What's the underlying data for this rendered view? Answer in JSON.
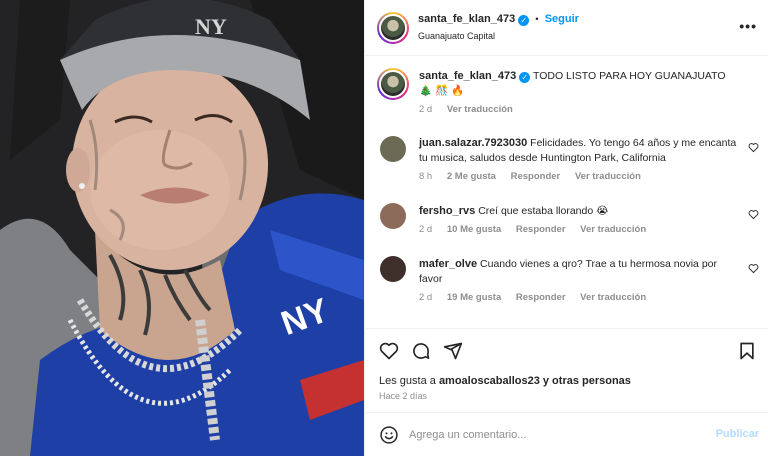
{
  "post": {
    "username": "santa_fe_klan_473",
    "follow_label": "Seguir",
    "dot": "•",
    "location": "Guanajuato Capital",
    "caption": "TODO LISTO PARA HOY GUANAJUATO 🎄 🎊 🔥",
    "caption_time": "2 d",
    "caption_translate": "Ver traducción"
  },
  "comments": [
    {
      "username": "juan.salazar.7923030",
      "text": "Felicidades. Yo tengo 64 años y me encanta tu musica, saludos desde Huntington Park, California",
      "time": "8 h",
      "likes": "2 Me gusta",
      "reply": "Responder",
      "translate": "Ver traducción",
      "avatar_color": "#6b6a55"
    },
    {
      "username": "fersho_rvs",
      "text": "Creí que estaba llorando 😭",
      "time": "2 d",
      "likes": "10 Me gusta",
      "reply": "Responder",
      "translate": "Ver traducción",
      "avatar_color": "#8d6b5a"
    },
    {
      "username": "mafer_olve",
      "text": "Cuando vienes a qro? Trae a tu hermosa novia por favor",
      "time": "2 d",
      "likes": "19 Me gusta",
      "reply": "Responder",
      "translate": "Ver traducción",
      "avatar_color": "#3e2f2a"
    }
  ],
  "engagement": {
    "likes_prefix": "Les gusta a ",
    "liker": "amoaloscaballos23",
    "likes_suffix": " y otras personas",
    "time_ago": "Hace 2 días"
  },
  "composer": {
    "placeholder": "Agrega un comentario...",
    "publish_label": "Publicar"
  },
  "icons": {
    "more": "more-options-icon",
    "heart": "heart-icon",
    "comment": "comment-icon",
    "share": "share-icon",
    "save": "bookmark-icon",
    "emoji": "emoji-icon"
  },
  "colors": {
    "accent": "#0095f6",
    "verified": "#0095f6",
    "muted": "#8e8e8e",
    "publish_disabled": "#b3dbff"
  }
}
